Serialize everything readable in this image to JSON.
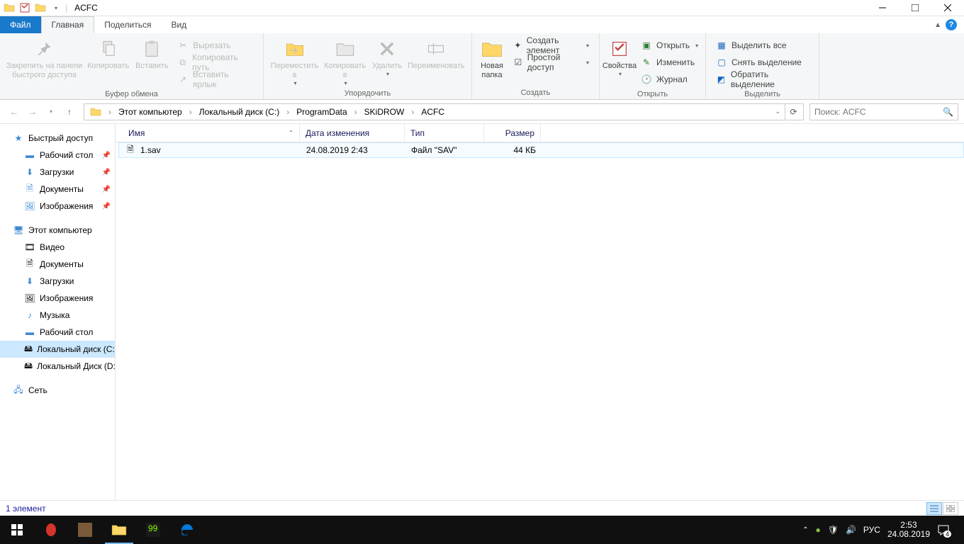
{
  "window": {
    "title": "ACFC"
  },
  "tabs": {
    "file": "Файл",
    "home": "Главная",
    "share": "Поделиться",
    "view": "Вид"
  },
  "ribbon": {
    "clipboard": {
      "label": "Буфер обмена",
      "pin": "Закрепить на панели\nбыстрого доступа",
      "copy": "Копировать",
      "paste": "Вставить",
      "cut": "Вырезать",
      "copy_path": "Копировать путь",
      "paste_shortcut": "Вставить ярлык"
    },
    "organize": {
      "label": "Упорядочить",
      "move_to": "Переместить\nв",
      "copy_to": "Копировать\nв",
      "delete": "Удалить",
      "rename": "Переименовать"
    },
    "create": {
      "label": "Создать",
      "new_folder": "Новая\nпапка",
      "new_item": "Создать элемент",
      "easy_access": "Простой доступ"
    },
    "open": {
      "label": "Открыть",
      "properties": "Свойства",
      "open": "Открыть",
      "edit": "Изменить",
      "history": "Журнал"
    },
    "select": {
      "label": "Выделить",
      "select_all": "Выделить все",
      "select_none": "Снять выделение",
      "invert": "Обратить выделение"
    }
  },
  "breadcrumb": [
    "Этот компьютер",
    "Локальный диск (C:)",
    "ProgramData",
    "SKiDROW",
    "ACFC"
  ],
  "search": {
    "placeholder": "Поиск: ACFC"
  },
  "columns": {
    "name": "Имя",
    "date": "Дата изменения",
    "type": "Тип",
    "size": "Размер"
  },
  "files": [
    {
      "name": "1.sav",
      "date": "24.08.2019 2:43",
      "type": "Файл \"SAV\"",
      "size": "44 КБ"
    }
  ],
  "sidebar": {
    "quick_access": "Быстрый доступ",
    "desktop": "Рабочий стол",
    "downloads": "Загрузки",
    "documents": "Документы",
    "pictures": "Изображения",
    "this_pc": "Этот компьютер",
    "videos": "Видео",
    "documents2": "Документы",
    "downloads2": "Загрузки",
    "pictures2": "Изображения",
    "music": "Музыка",
    "desktop2": "Рабочий стол",
    "local_c": "Локальный диск (C:)",
    "local_d": "Локальный Диск (D:)",
    "network": "Сеть"
  },
  "status": {
    "text": "1 элемент"
  },
  "taskbar": {
    "lang": "РУС",
    "time": "2:53",
    "date": "24.08.2019",
    "notif_count": "4"
  }
}
